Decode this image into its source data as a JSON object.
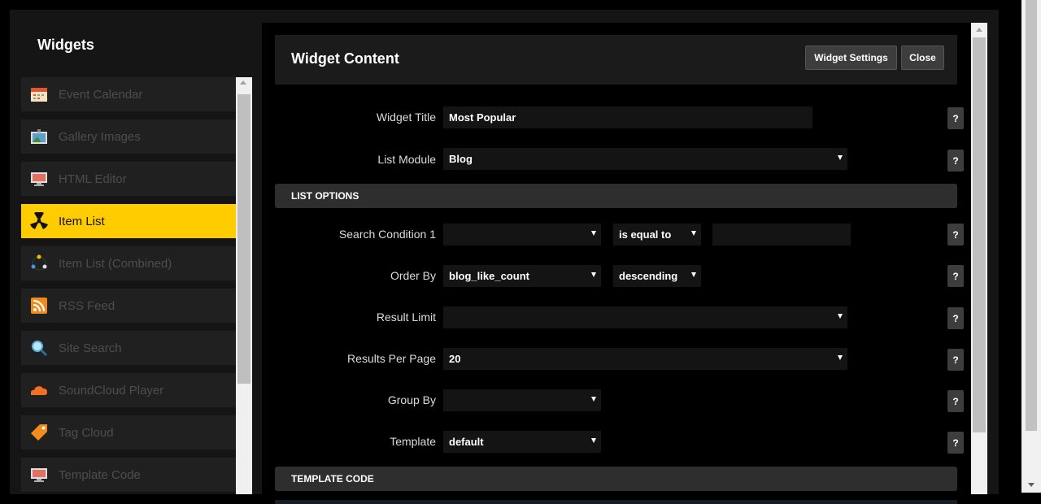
{
  "sidebar": {
    "title": "Widgets",
    "items": [
      {
        "label": "Event Calendar",
        "icon": "calendar-icon"
      },
      {
        "label": "Gallery Images",
        "icon": "picture-icon"
      },
      {
        "label": "HTML Editor",
        "icon": "monitor-icon"
      },
      {
        "label": "Item List",
        "icon": "radiation-icon",
        "active": true
      },
      {
        "label": "Item List (Combined)",
        "icon": "dots-circle-icon"
      },
      {
        "label": "RSS Feed",
        "icon": "rss-icon"
      },
      {
        "label": "Site Search",
        "icon": "magnifier-icon"
      },
      {
        "label": "SoundCloud Player",
        "icon": "cloud-icon"
      },
      {
        "label": "Tag Cloud",
        "icon": "tag-icon"
      },
      {
        "label": "Template Code",
        "icon": "monitor-icon"
      }
    ]
  },
  "header": {
    "title": "Widget Content",
    "settings_label": "Widget Settings",
    "close_label": "Close"
  },
  "form": {
    "widget_title": {
      "label": "Widget Title",
      "value": "Most Popular"
    },
    "list_module": {
      "label": "List Module",
      "value": "Blog"
    },
    "list_options_heading": "LIST OPTIONS",
    "search_condition": {
      "label": "Search Condition 1",
      "field_value": "",
      "operator": "is equal to",
      "value": ""
    },
    "order_by": {
      "label": "Order By",
      "value": "blog_like_count",
      "direction": "descending"
    },
    "result_limit": {
      "label": "Result Limit",
      "value": ""
    },
    "results_per_page": {
      "label": "Results Per Page",
      "value": "20"
    },
    "group_by": {
      "label": "Group By",
      "value": ""
    },
    "template": {
      "label": "Template",
      "value": "default"
    },
    "template_code_heading": "TEMPLATE CODE",
    "help_label": "?"
  },
  "colors": {
    "accent": "#ffcc00",
    "background": "#000000",
    "panel": "#151515"
  }
}
